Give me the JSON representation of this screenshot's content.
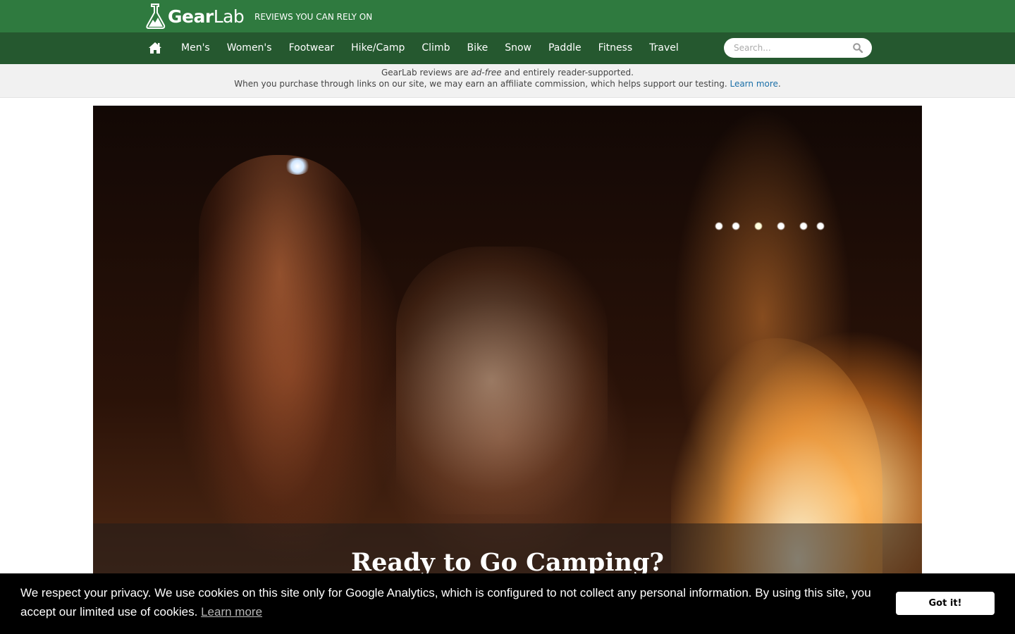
{
  "header": {
    "logo_bold": "Gear",
    "logo_light": "Lab",
    "tagline": "REVIEWS YOU CAN RELY ON",
    "logo_icon": "flask-mountain-icon",
    "brand_color": "#2f7a3f"
  },
  "nav": {
    "home_icon": "home-icon",
    "items": [
      {
        "label": "Men's"
      },
      {
        "label": "Women's"
      },
      {
        "label": "Footwear"
      },
      {
        "label": "Hike/Camp"
      },
      {
        "label": "Climb"
      },
      {
        "label": "Bike"
      },
      {
        "label": "Snow"
      },
      {
        "label": "Paddle"
      },
      {
        "label": "Fitness"
      },
      {
        "label": "Travel"
      }
    ],
    "search": {
      "placeholder": "Search...",
      "value": "",
      "icon": "search-icon"
    },
    "bar_color": "#25582f"
  },
  "notice": {
    "line1_pre": "GearLab reviews are ",
    "line1_em": "ad-free",
    "line1_post": " and entirely reader-supported.",
    "line2": "When you purchase through links on our site, we may earn an affiliate commission, which helps support our testing. ",
    "learn_more": "Learn more",
    "period": "."
  },
  "hero": {
    "title": "Ready to Go Camping?"
  },
  "cookie": {
    "text": "We respect your privacy. We use cookies on this site only for Google Analytics, which is configured to not collect any personal information. By using this site, you accept our limited use of cookies.",
    "learn_more": "Learn more",
    "button": "Got it!"
  }
}
